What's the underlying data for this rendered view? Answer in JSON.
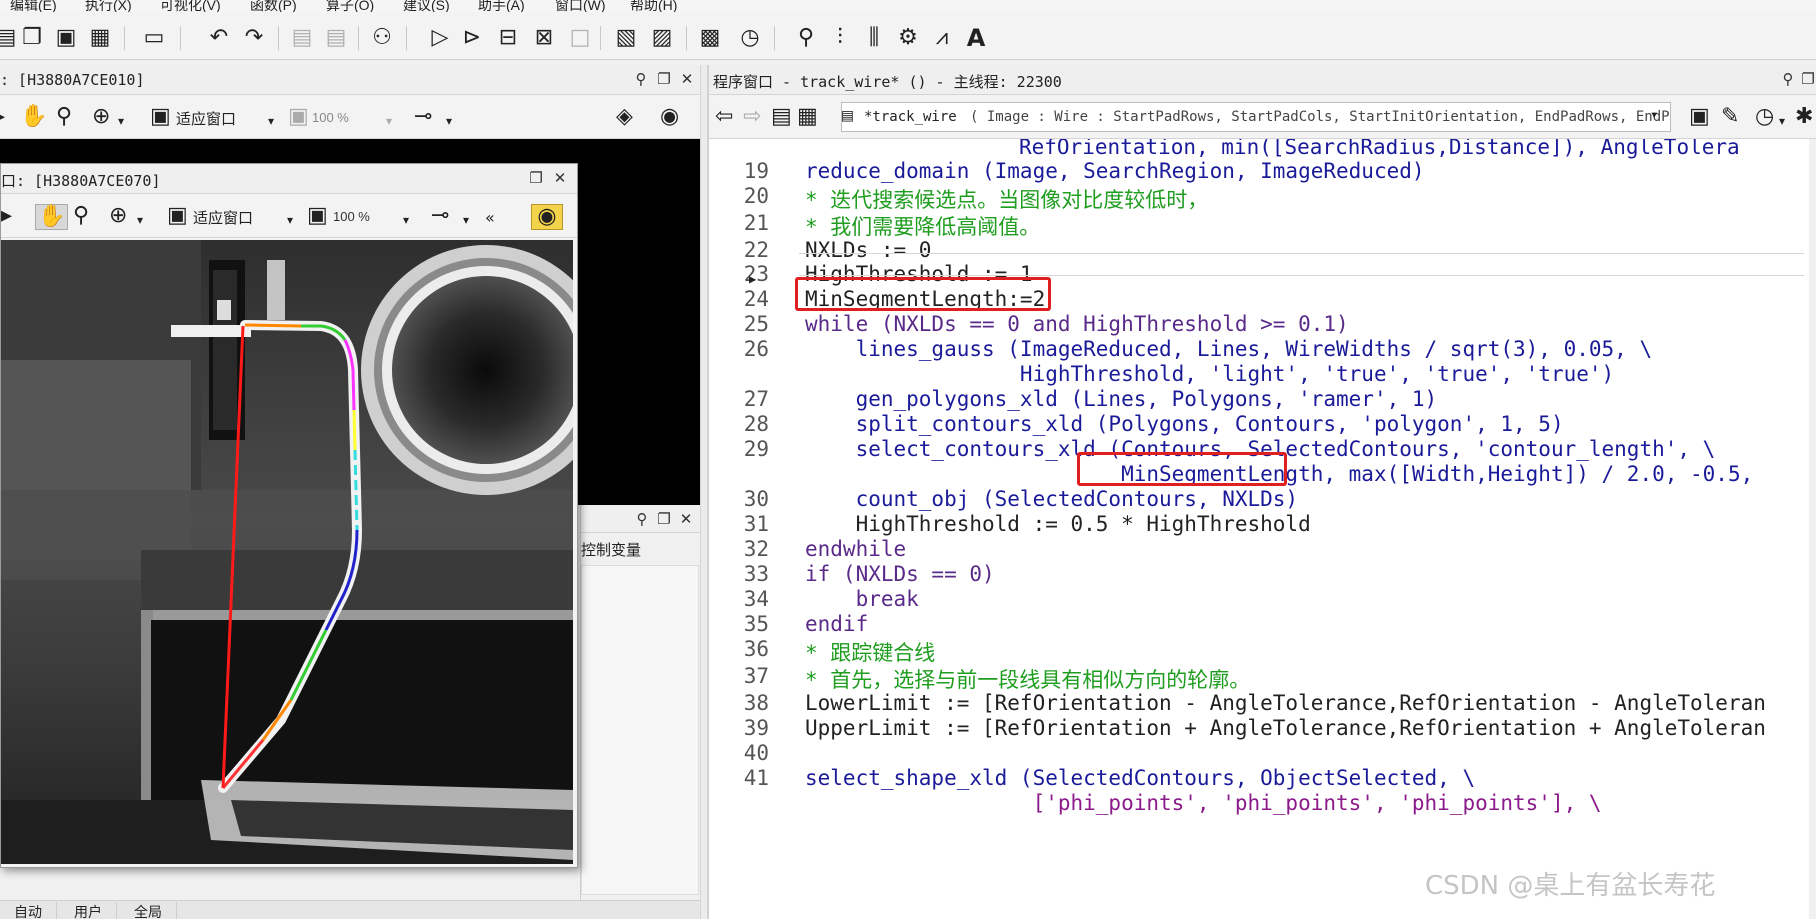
{
  "menu": {
    "items": [
      "编辑(E)",
      "执行(X)",
      "可视化(V)",
      "函数(P)",
      "算子(O)",
      "建议(S)",
      "助手(A)",
      "窗口(W)",
      "帮助(H)"
    ]
  },
  "toolbar": {
    "icons": [
      "new-file-icon",
      "open-file-icon",
      "save-icon",
      "save-all-icon",
      "record-icon",
      "undo-icon",
      "redo-icon",
      "comment-icon",
      "uncomment-icon",
      "find-icon",
      "run-icon",
      "step-over-icon",
      "step-into-icon",
      "step-out-icon",
      "stop-icon",
      "insert-icon",
      "edit-icon",
      "profiler-icon",
      "timer-icon",
      "zoom-icon",
      "histogram-icon",
      "line-profile-icon",
      "gray-histogram-icon",
      "feature-icon",
      "ocr-icon"
    ]
  },
  "graphics_back": {
    "title": ": [H3880A7CE010]",
    "fit_label": "适应窗口",
    "zoom": "100 %"
  },
  "graphics_front": {
    "title": "口: [H3880A7CE070]",
    "fit_label": "适应窗口",
    "zoom": "100 %",
    "more": "«"
  },
  "variables": {
    "label": "控制变量"
  },
  "bottom_tabs": [
    "自动",
    "用户",
    "全局"
  ],
  "program": {
    "title": "程序窗口 - track_wire* () - 主线程: 22300",
    "procedure_name": "*track_wire",
    "signature": "( Image : Wire : StartPadRows, StartPadCols, StartInitOrientation, EndPadRows, EndP"
  },
  "code": {
    "continuation": "RefOrientation, min([SearchRadius,Distance]), AngleTolera",
    "lines": [
      {
        "n": "19",
        "text": "reduce_domain (Image, SearchRegion, ImageReduced)"
      },
      {
        "n": "20",
        "text": "* 迭代搜索候选点。当图像对比度较低时，"
      },
      {
        "n": "21",
        "text": "* 我们需要降低高阈值。"
      },
      {
        "n": "22",
        "text": "NXLDs := 0"
      },
      {
        "n": "23",
        "text": "HighThreshold := 1"
      },
      {
        "n": "24",
        "text": "MinSegmentLength:=2"
      },
      {
        "n": "25",
        "text": "while (NXLDs == 0 and HighThreshold >= 0.1)"
      },
      {
        "n": "26",
        "text": "    lines_gauss (ImageReduced, Lines, WireWidths / sqrt(3), 0.05, \\"
      },
      {
        "n": "",
        "text": "                 HighThreshold, 'light', 'true', 'true', 'true')"
      },
      {
        "n": "27",
        "text": "    gen_polygons_xld (Lines, Polygons, 'ramer', 1)"
      },
      {
        "n": "28",
        "text": "    split_contours_xld (Polygons, Contours, 'polygon', 1, 5)"
      },
      {
        "n": "29",
        "text": "    select_contours_xld (Contours, SelectedContours, 'contour_length', \\"
      },
      {
        "n": "",
        "text": "                         MinSegmentLength, max([Width,Height]) / 2.0, -0.5,"
      },
      {
        "n": "30",
        "text": "    count_obj (SelectedContours, NXLDs)"
      },
      {
        "n": "31",
        "text": "    HighThreshold := 0.5 * HighThreshold"
      },
      {
        "n": "32",
        "text": "endwhile"
      },
      {
        "n": "33",
        "text": "if (NXLDs == 0)"
      },
      {
        "n": "34",
        "text": "    break"
      },
      {
        "n": "35",
        "text": "endif"
      },
      {
        "n": "36",
        "text": "* 跟踪键合线"
      },
      {
        "n": "37",
        "text": "* 首先，选择与前一段线具有相似方向的轮廓。"
      },
      {
        "n": "38",
        "text": "LowerLimit := [RefOrientation - AngleTolerance,RefOrientation - AngleToleran"
      },
      {
        "n": "39",
        "text": "UpperLimit := [RefOrientation + AngleTolerance,RefOrientation + AngleToleran"
      },
      {
        "n": "40",
        "text": ""
      },
      {
        "n": "41",
        "text": "select_shape_xld (SelectedContours, ObjectSelected, \\"
      },
      {
        "n": "",
        "text": "                  ['phi_points', 'phi_points', 'phi_points'], \\"
      }
    ]
  },
  "watermark": "CSDN @桌上有盆长寿花",
  "colors": {
    "highlight": "#e02020",
    "operator": "#1b1b9a",
    "comment": "#1f9d1f",
    "string": "#8b1a8b"
  }
}
